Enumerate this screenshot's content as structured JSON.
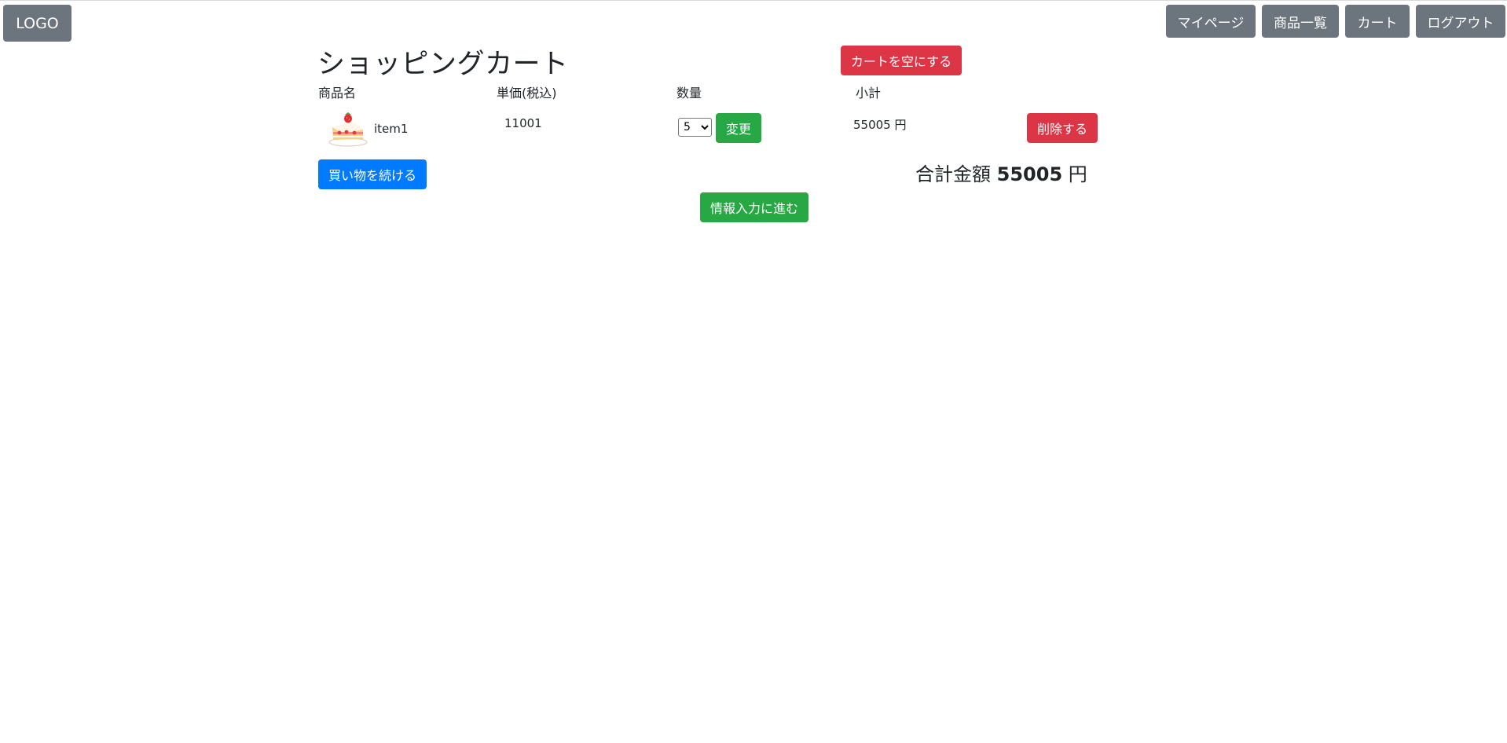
{
  "header": {
    "logo_label": "LOGO",
    "nav": {
      "mypage": "マイページ",
      "products": "商品一覧",
      "cart": "カート",
      "logout": "ログアウト"
    }
  },
  "cart": {
    "title": "ショッピングカート",
    "empty_label": "カートを空にする",
    "columns": {
      "name": "商品名",
      "price": "単価(税込)",
      "quantity": "数量",
      "subtotal": "小計"
    },
    "items": [
      {
        "image_icon": "cake-icon",
        "name": "item1",
        "price": "11001",
        "quantity": "5",
        "change_label": "変更",
        "subtotal": "55005 円",
        "delete_label": "削除する"
      }
    ],
    "continue_label": "買い物を続ける",
    "total_label": "合計金額",
    "total_amount": "55005",
    "total_unit": "円",
    "proceed_label": "情報入力に進む"
  },
  "colors": {
    "secondary": "#6c757d",
    "danger": "#dc3545",
    "success": "#28a745",
    "primary": "#007bff"
  }
}
